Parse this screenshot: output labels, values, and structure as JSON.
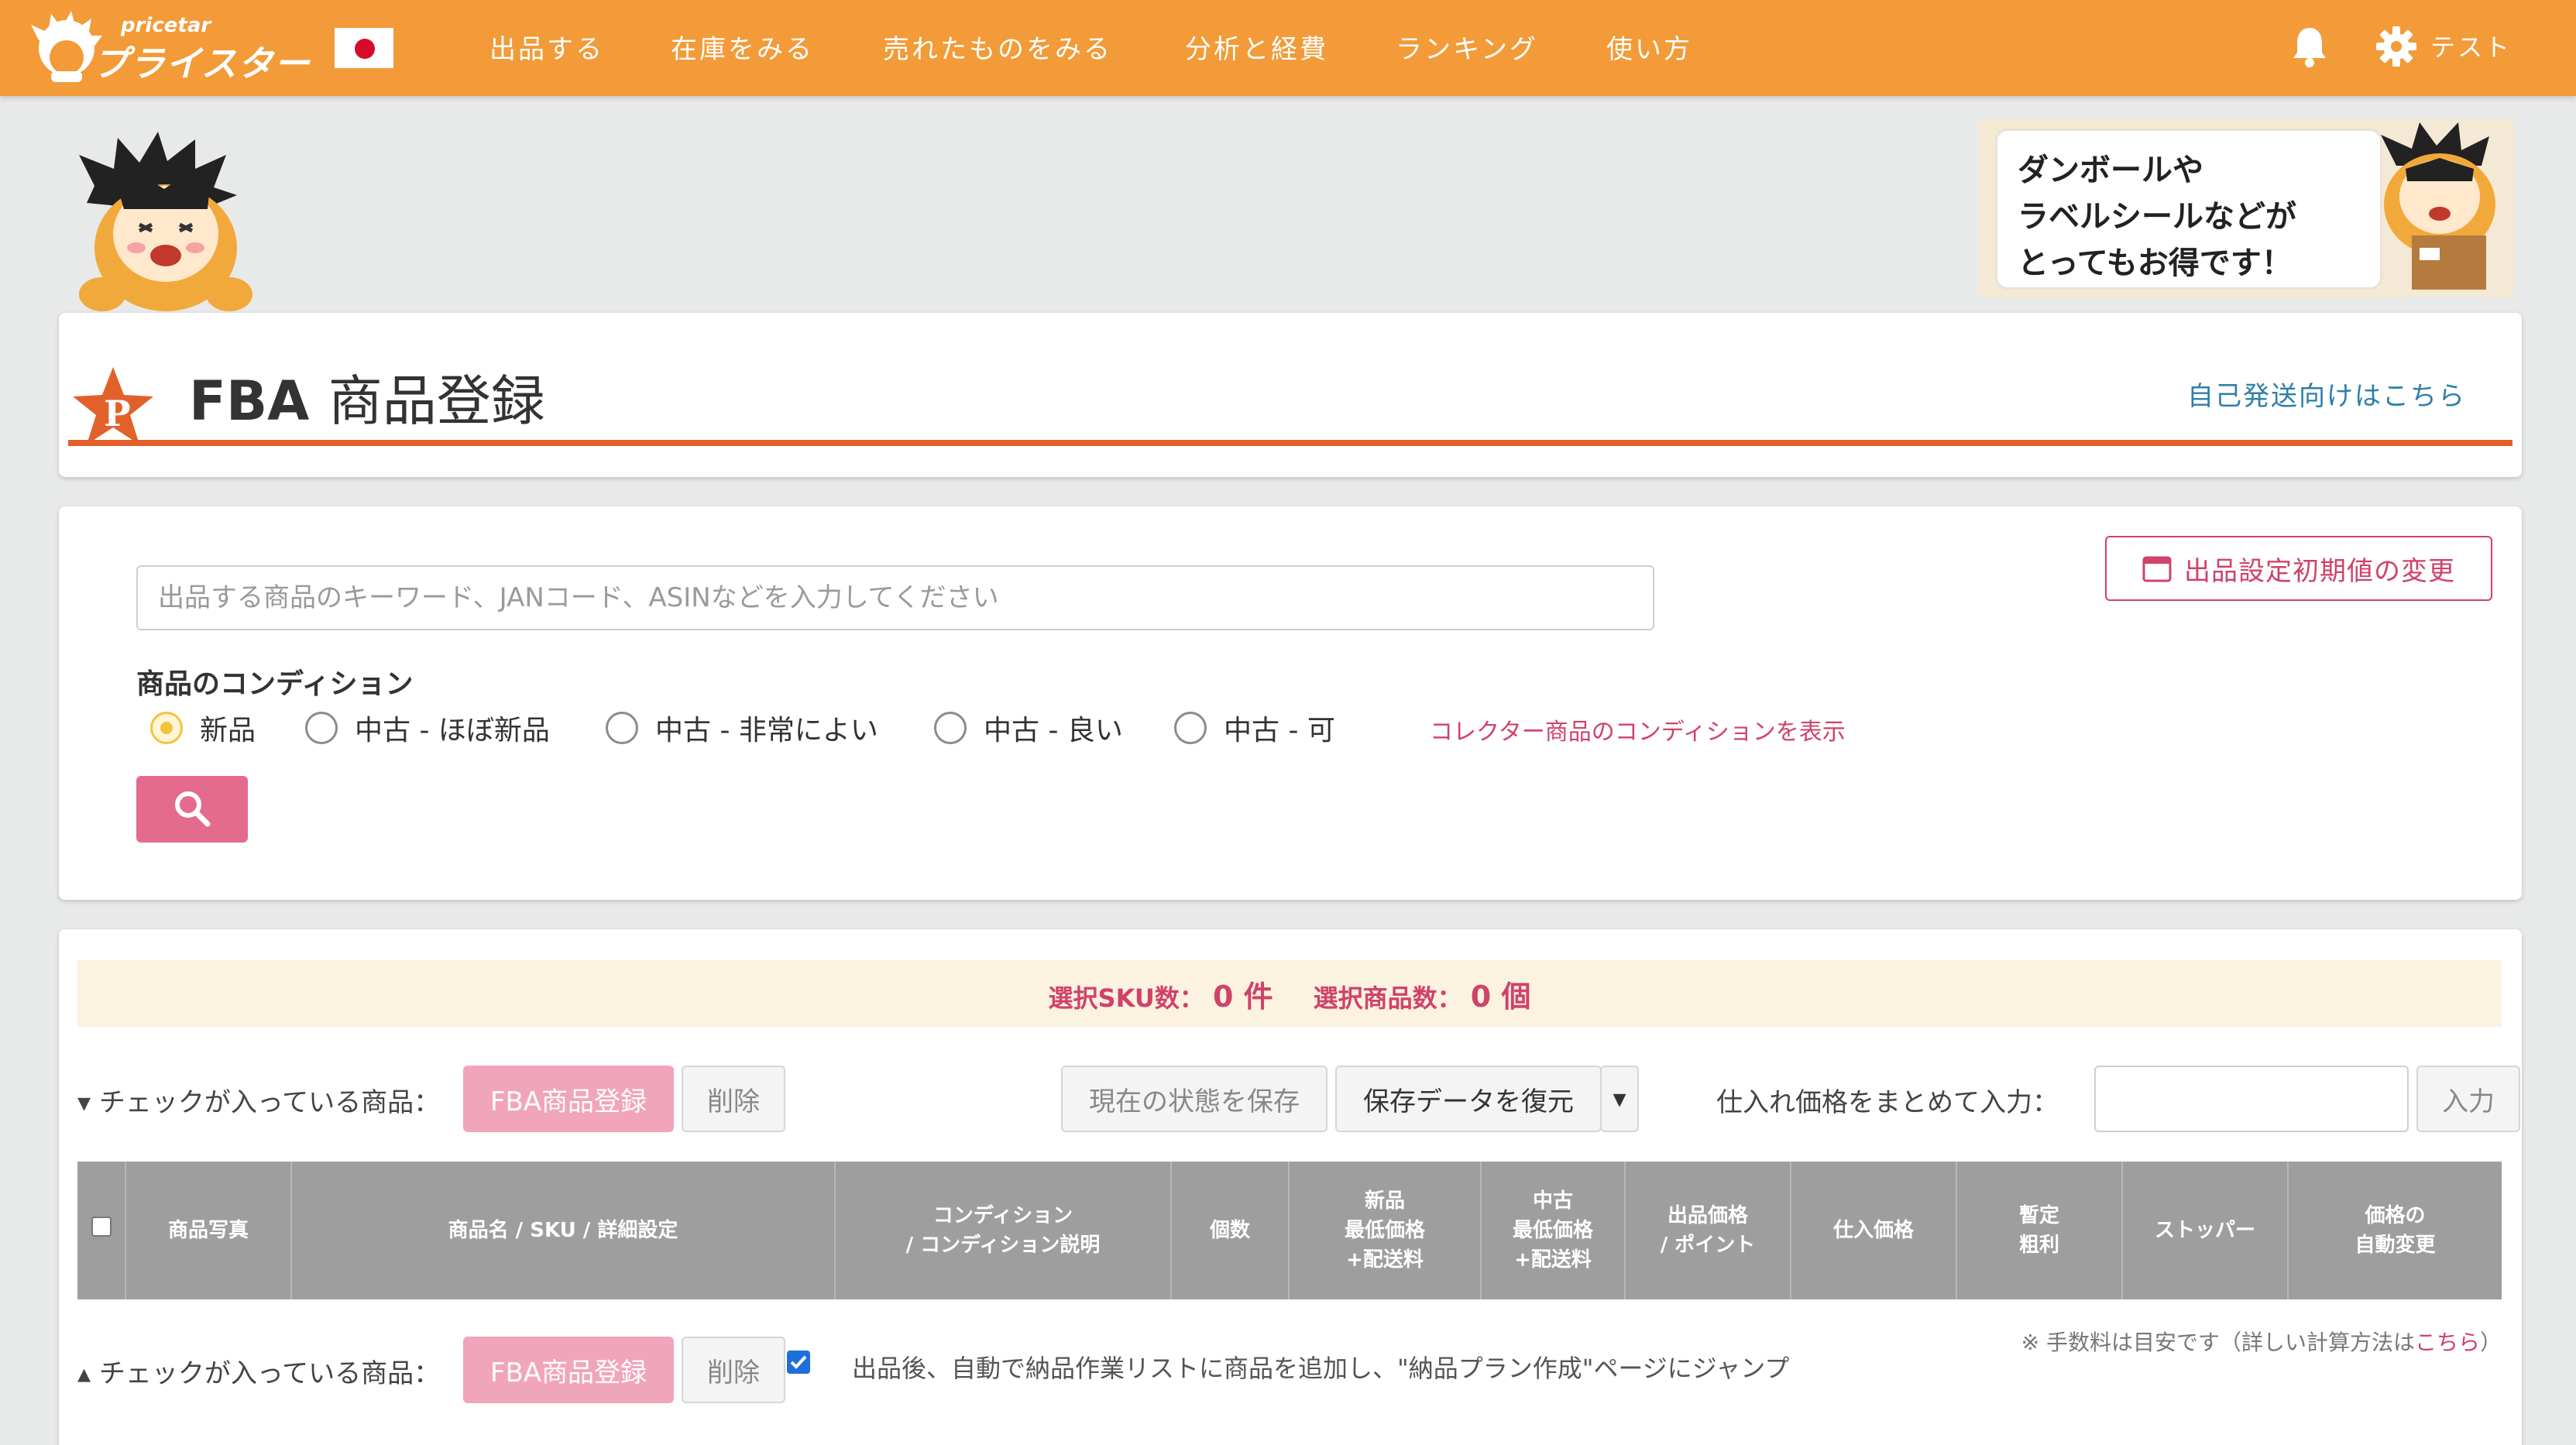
{
  "app": {
    "logo_small": "pricetar",
    "logo_main": "プライスター",
    "colors": {
      "brand": "#f29b38",
      "accent": "#d0426a",
      "title_rule": "#e2612a",
      "table_header": "#9e9e9e"
    }
  },
  "nav": {
    "items": [
      "出品する",
      "在庫をみる",
      "売れたものをみる",
      "分析と経費",
      "ランキング",
      "使い方"
    ],
    "bell_icon": "bell-icon",
    "settings_icon": "gear-icon",
    "user": "テスト"
  },
  "banner": {
    "lines": [
      "ダンボールや",
      "ラベルシールなどが",
      "とってもお得です！"
    ]
  },
  "page": {
    "title_en": "FBA",
    "title_jp": "商品登録",
    "self_ship_link": "自己発送向けはこちら"
  },
  "search": {
    "placeholder": "出品する商品のキーワード、JANコード、ASINなどを入力してください",
    "settings_button": "出品設定初期値の変更",
    "condition_label": "商品のコンディション",
    "conditions": [
      "新品",
      "中古 - ほぼ新品",
      "中古 - 非常によい",
      "中古 - 良い",
      "中古 - 可"
    ],
    "selected_condition": "新品",
    "collector_link": "コレクター商品のコンディションを表示"
  },
  "summary": {
    "sku_label": "選択SKU数：",
    "sku_value": "0 件",
    "items_label": "選択商品数：",
    "items_value": "0 個"
  },
  "actions": {
    "checked_label": "チェックが入っている商品：",
    "fba_register": "FBA商品登録",
    "delete": "削除",
    "save_state": "現在の状態を保存",
    "restore": "保存データを復元",
    "bulk_price_label": "仕入れ価格をまとめて入力：",
    "enter": "入力"
  },
  "table": {
    "headers": [
      "商品写真",
      "商品名 / SKU / 詳細設定",
      "コンディション\n/ コンディション説明",
      "個数",
      "新品\n最低価格\n+配送料",
      "中古\n最低価格\n+配送料",
      "出品価格\n/ ポイント",
      "仕入価格",
      "暫定\n粗利",
      "ストッパー",
      "価格の\n自動変更"
    ]
  },
  "footer": {
    "fee_note": "※ 手数料は目安です（詳しい計算方法は",
    "fee_link": "こちら",
    "fee_close": "）",
    "auto_add": "出品後、自動で納品作業リストに商品を追加し、\"納品プラン作成\"ページにジャンプ"
  }
}
